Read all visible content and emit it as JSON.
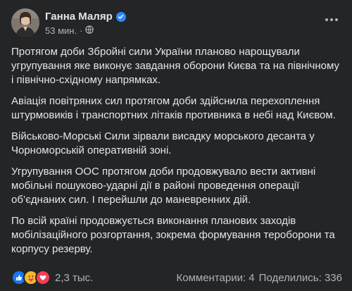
{
  "post": {
    "author": "Ганна Маляр",
    "time": "53 мин.",
    "separator": "·",
    "paragraphs": [
      "Протягом доби Збройні сили України планово нарощували угрупування яке виконує завдання оборони Києва та на північному і північно-східному напрямках.",
      "Авіація повітряних сил протягом доби здійснила перехоплення штурмовиків і транспортних літаків противника в небі над Києвом.",
      "Військово-Морські Сили зірвали висадку морського десанта у Чорноморській оперативній зоні.",
      "Угрупування ООС протягом доби продовжувало вести активні мобільні пошуково-ударні дії в районі проведення операції об’єднаних сил. І перейшли до маневренних дій.",
      "По всій країні продовжується  виконання планових заходів мобілізаційного розгортання, зокрема формування тероборони та корпусу резерву."
    ]
  },
  "footer": {
    "reactions_count": "2,3 тыс.",
    "reaction_icons": [
      "like-icon",
      "care-icon",
      "love-icon"
    ],
    "comments": "Комментарии: 4",
    "shares": "Поделились: 336"
  },
  "colors": {
    "background": "#242526",
    "text": "#e4e6eb",
    "secondary": "#b0b3b8",
    "accent": "#2d88ff"
  }
}
